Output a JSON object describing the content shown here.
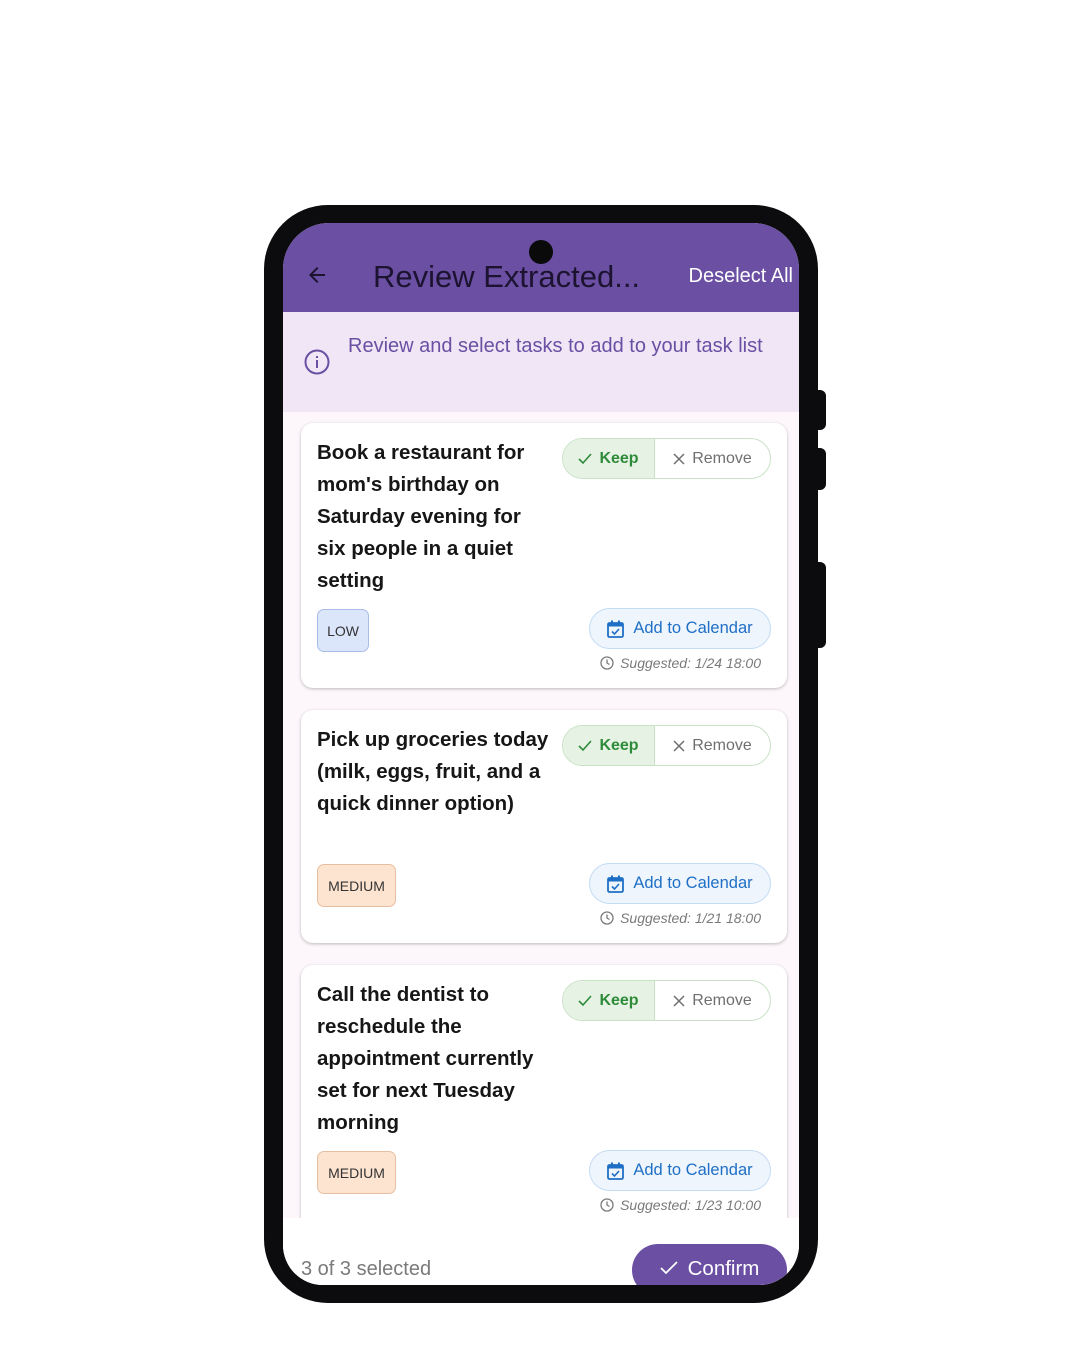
{
  "appbar": {
    "title": "Review Extracted...",
    "deselect_label": "Deselect All"
  },
  "banner": {
    "text": "Review and select tasks to add to your task list"
  },
  "tasks": [
    {
      "title": "Book a restaurant for mom's birthday on Saturday evening for six people in a quiet setting",
      "keep_label": "Keep",
      "remove_label": "Remove",
      "priority": "LOW",
      "calendar_label": "Add to Calendar",
      "suggested": "Suggested: 1/24 18:00"
    },
    {
      "title": "Pick up groceries today (milk, eggs, fruit, and a quick dinner option)",
      "keep_label": "Keep",
      "remove_label": "Remove",
      "priority": "MEDIUM",
      "calendar_label": "Add to Calendar",
      "suggested": "Suggested: 1/21 18:00"
    },
    {
      "title": "Call the dentist to reschedule the appointment currently set for next Tuesday morning",
      "keep_label": "Keep",
      "remove_label": "Remove",
      "priority": "MEDIUM",
      "calendar_label": "Add to Calendar",
      "suggested": "Suggested: 1/23 10:00"
    }
  ],
  "footer": {
    "selected_text": "3 of 3 selected",
    "confirm_label": "Confirm"
  },
  "colors": {
    "primary": "#6a4fa3",
    "banner_bg": "#f0e6f6",
    "keep_green": "#2e8b3a",
    "calendar_blue": "#1f6fc6",
    "low_badge": "#dbe6fb",
    "medium_badge": "#fde4d1"
  },
  "icons": [
    "back-arrow-icon",
    "info-icon",
    "check-icon",
    "close-icon",
    "calendar-icon",
    "clock-icon"
  ]
}
